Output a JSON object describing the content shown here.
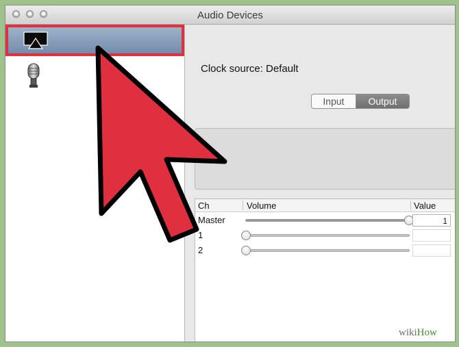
{
  "window": {
    "title": "Audio Devices"
  },
  "sidebar": {
    "devices": [
      {
        "icon": "airplay-icon",
        "name": "",
        "selected": true
      },
      {
        "icon": "microphone-icon",
        "name": "",
        "selected": false
      }
    ]
  },
  "main": {
    "clock_source": "Clock source:  Default",
    "tabs": [
      {
        "label": "Input",
        "selected": false
      },
      {
        "label": "Output",
        "selected": true
      }
    ],
    "table": {
      "columns": [
        "Ch",
        "Volume",
        "Value"
      ],
      "rows": [
        {
          "channel": "Master",
          "volume": 1.0,
          "value": "1",
          "enabled": true
        },
        {
          "channel": "1",
          "volume": 0.0,
          "value": "",
          "enabled": false
        },
        {
          "channel": "2",
          "volume": 0.0,
          "value": "",
          "enabled": false
        }
      ]
    }
  },
  "overlay": {
    "arrow_color": "#e0303f",
    "highlight_color": "#e0303f"
  },
  "watermark": {
    "part1": "wiki",
    "part2": "How"
  }
}
